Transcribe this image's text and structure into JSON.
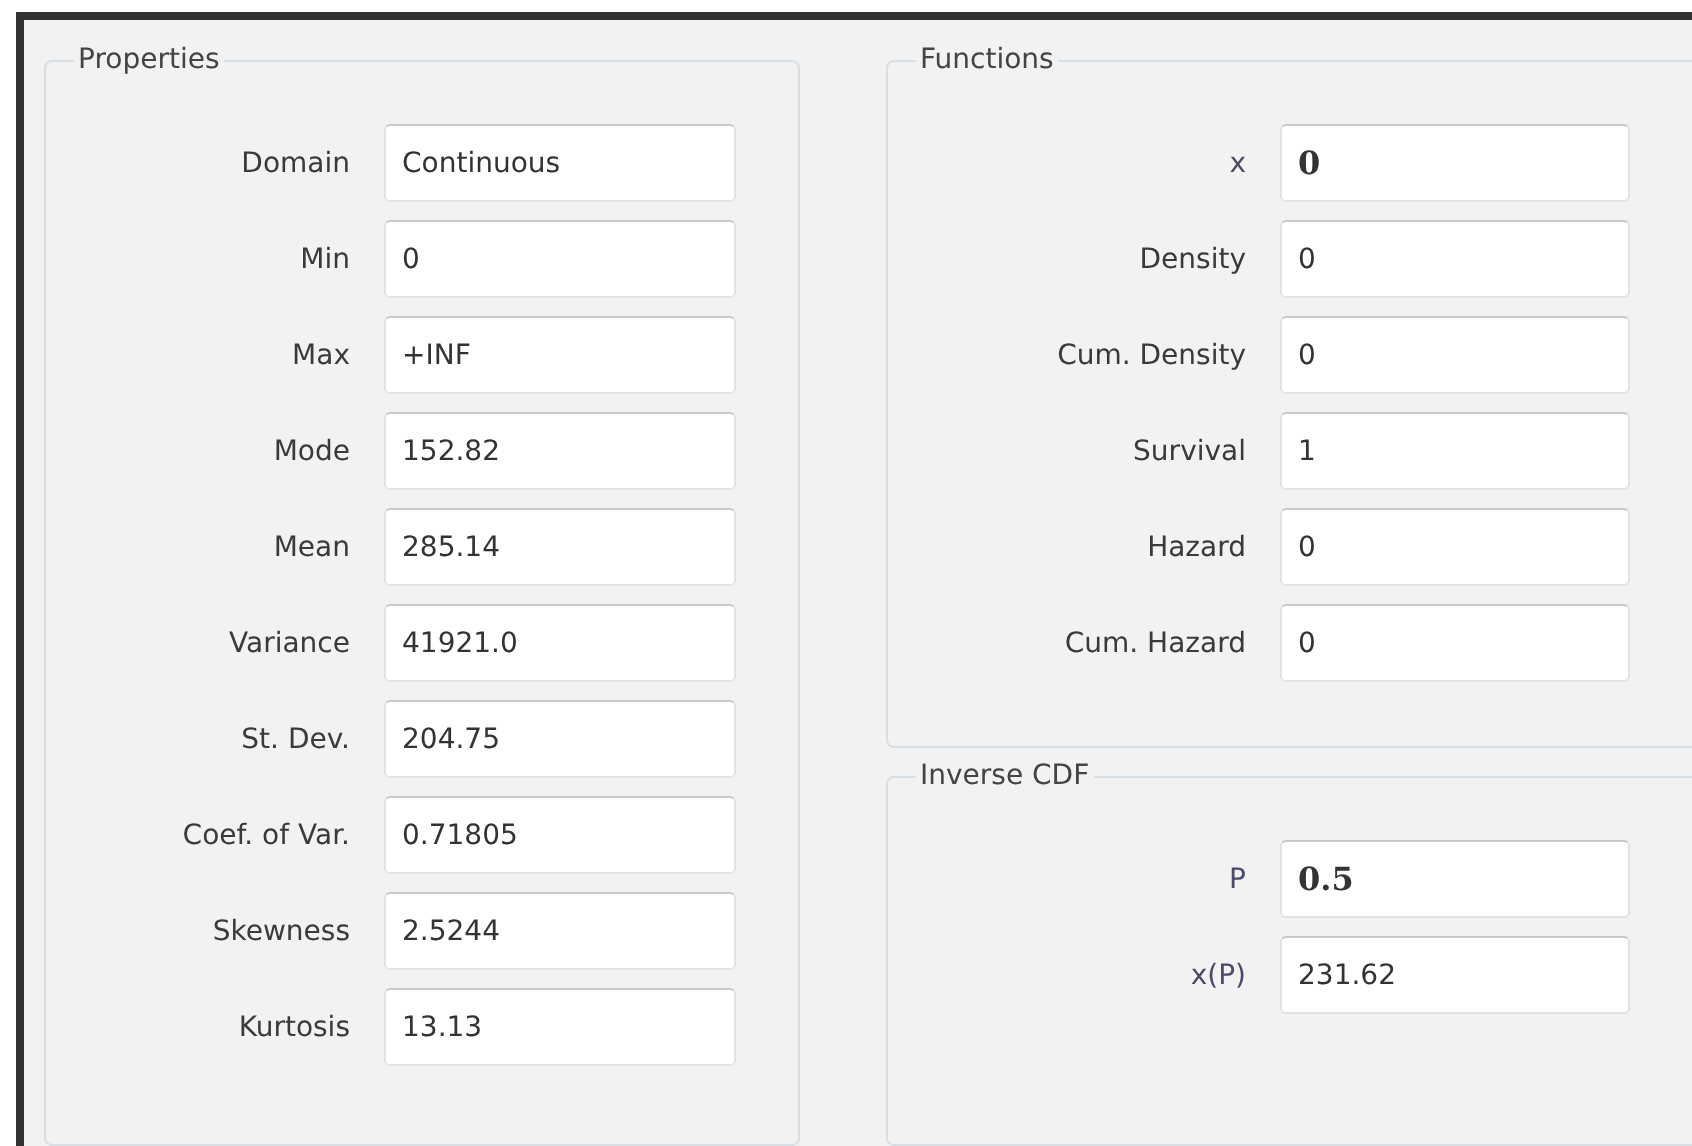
{
  "left_column": {
    "groups": [
      {
        "title": "Properties",
        "rows": [
          {
            "label": "Domain",
            "value": "Continuous",
            "kind": "plain"
          },
          {
            "label": "Min",
            "value": "0",
            "kind": "plain"
          },
          {
            "label": "Max",
            "value": "+INF",
            "kind": "plain"
          },
          {
            "label": "Mode",
            "value": "152.82",
            "kind": "plain"
          },
          {
            "label": "Mean",
            "value": "285.14",
            "kind": "plain"
          },
          {
            "label": "Variance",
            "value": "41921.0",
            "kind": "plain"
          },
          {
            "label": "St. Dev.",
            "value": "204.75",
            "kind": "plain"
          },
          {
            "label": "Coef. of Var.",
            "value": "0.71805",
            "kind": "plain"
          },
          {
            "label": "Skewness",
            "value": "2.5244",
            "kind": "plain"
          },
          {
            "label": "Kurtosis",
            "value": "13.13",
            "kind": "plain"
          }
        ]
      }
    ]
  },
  "right_column": {
    "groups": [
      {
        "title": "Functions",
        "rows": [
          {
            "label": "x",
            "value": "0",
            "kind": "input"
          },
          {
            "label": "Density",
            "value": "0",
            "kind": "plain"
          },
          {
            "label": "Cum. Density",
            "value": "0",
            "kind": "plain"
          },
          {
            "label": "Survival",
            "value": "1",
            "kind": "plain"
          },
          {
            "label": "Hazard",
            "value": "0",
            "kind": "plain"
          },
          {
            "label": "Cum. Hazard",
            "value": "0",
            "kind": "plain"
          }
        ]
      },
      {
        "title": "Inverse CDF",
        "rows": [
          {
            "label": "P",
            "value": "0.5",
            "kind": "input"
          },
          {
            "label": "x(P)",
            "value": "231.62",
            "kind": "variable"
          }
        ]
      }
    ]
  }
}
